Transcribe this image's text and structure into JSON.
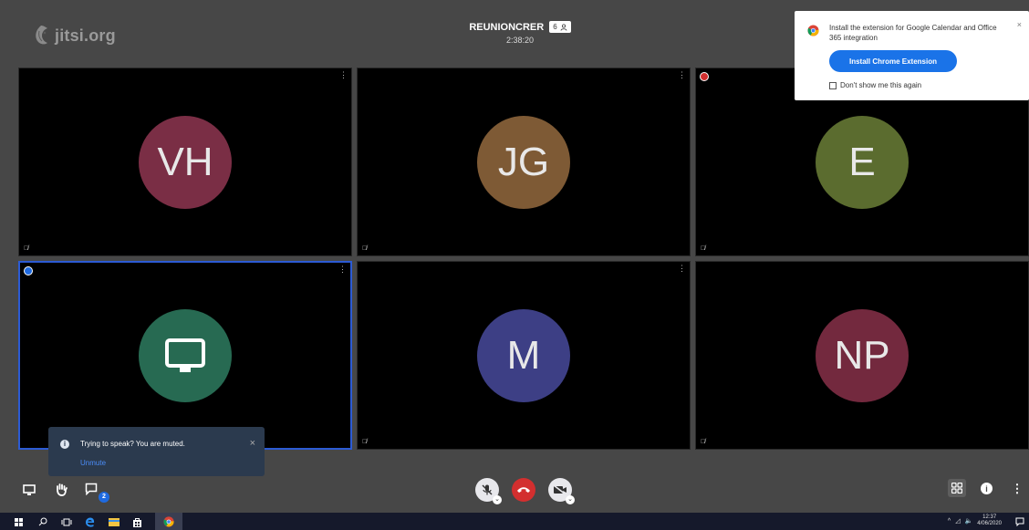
{
  "logo": {
    "text": "jitsi.org"
  },
  "meeting": {
    "name": "REUNIONCRER",
    "participant_count": "6",
    "timer": "2:38:20"
  },
  "tiles": [
    {
      "initials": "VH",
      "color": "#7a2e45"
    },
    {
      "initials": "JG",
      "color": "#7e5a35"
    },
    {
      "initials": "E",
      "color": "#5b6c2f"
    },
    {
      "initials": "",
      "color": "#276a52"
    },
    {
      "initials": "M",
      "color": "#3d3f85"
    },
    {
      "initials": "NP",
      "color": "#73293e"
    }
  ],
  "notification": {
    "text": "Trying to speak? You are muted.",
    "action": "Unmute",
    "close": "×"
  },
  "toolbar": {
    "chat_badge": "2"
  },
  "extension_popup": {
    "text": "Install the extension for Google Calendar and Office 365 integration",
    "button": "Install Chrome Extension",
    "checkbox_label": "Don't show me this again",
    "close": "×"
  },
  "taskbar": {
    "time": "12:37",
    "date": "4/06/2020"
  },
  "icons": {
    "screen_share": "screen-share-icon",
    "raise_hand": "raise-hand-icon",
    "chat": "chat-icon",
    "mic_muted": "mic-muted-icon",
    "hangup": "hangup-icon",
    "camera_off": "camera-off-icon",
    "tile_view": "tile-view-icon",
    "info": "info-icon",
    "more": "more-icon"
  },
  "colors": {
    "accent": "#1a73e8",
    "hangup": "#d32f2f",
    "active_border": "#2c5bd4"
  }
}
